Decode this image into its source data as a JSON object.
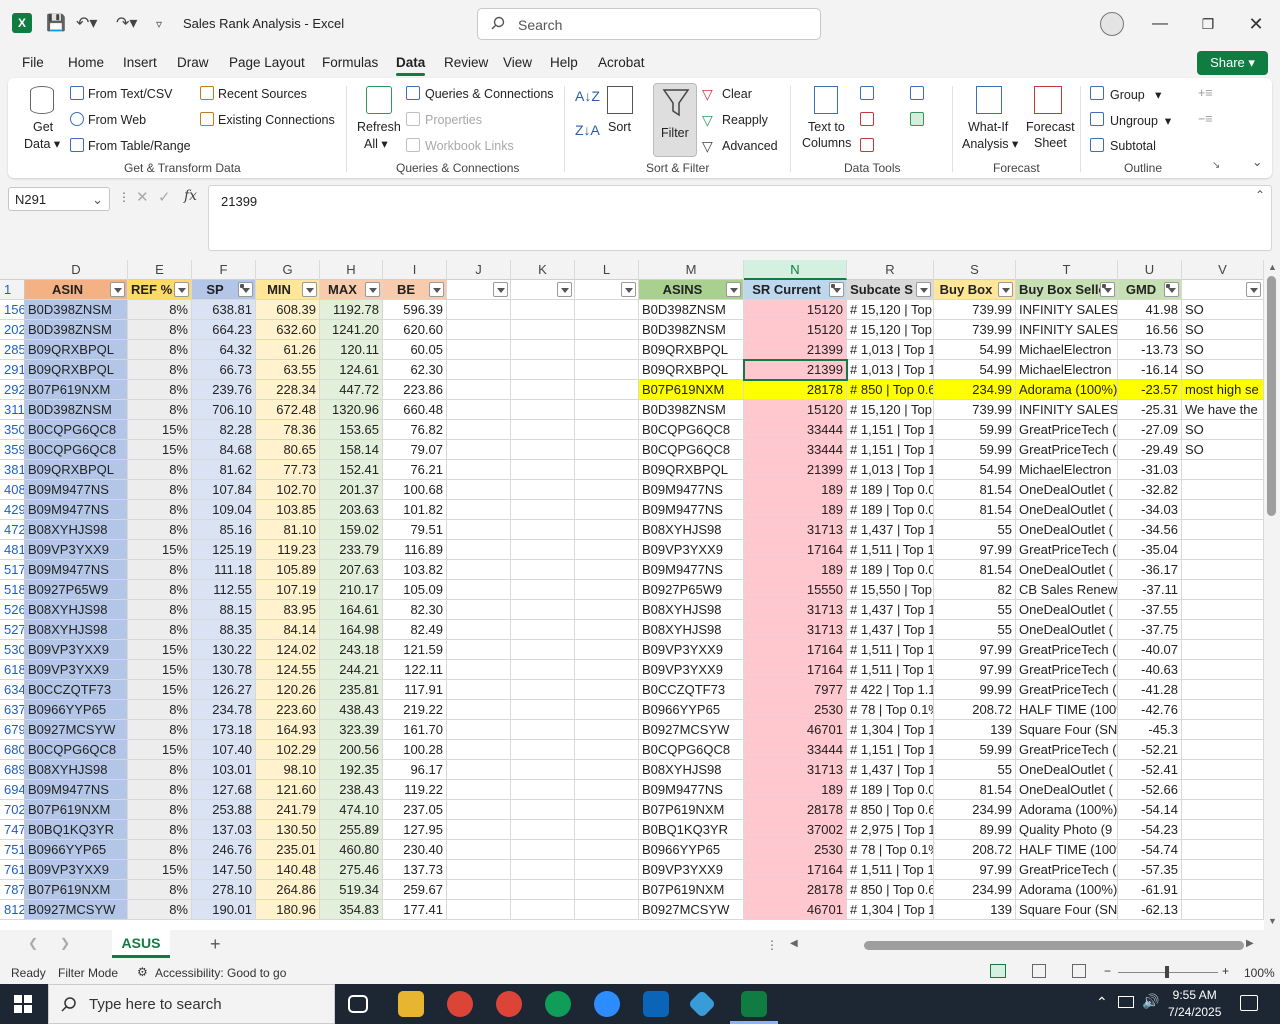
{
  "app": {
    "title": "Sales Rank Analysis  -  Excel",
    "logo": "X"
  },
  "search": {
    "placeholder": "Search"
  },
  "menu": [
    "File",
    "Home",
    "Insert",
    "Draw",
    "Page Layout",
    "Formulas",
    "Data",
    "Review",
    "View",
    "Help",
    "Acrobat"
  ],
  "active_menu": "Data",
  "share_label": "Share",
  "ribbon": {
    "get_data": [
      "Get",
      "Data"
    ],
    "from_text_csv": "From Text/CSV",
    "from_web": "From Web",
    "from_table": "From Table/Range",
    "recent_sources": "Recent Sources",
    "existing_connections": "Existing Connections",
    "group_get_transform": "Get & Transform Data",
    "refresh": [
      "Refresh",
      "All"
    ],
    "queries_connections": "Queries & Connections",
    "properties": "Properties",
    "workbook_links": "Workbook Links",
    "group_queries": "Queries & Connections",
    "sort": "Sort",
    "filter": "Filter",
    "clear": "Clear",
    "reapply": "Reapply",
    "advanced": "Advanced",
    "group_sort": "Sort & Filter",
    "text_to_columns": [
      "Text to",
      "Columns"
    ],
    "group_data_tools": "Data Tools",
    "what_if": [
      "What-If",
      "Analysis"
    ],
    "forecast_sheet": [
      "Forecast",
      "Sheet"
    ],
    "group_forecast": "Forecast",
    "group": "Group",
    "ungroup": "Ungroup",
    "subtotal": "Subtotal",
    "group_outline": "Outline"
  },
  "formula_bar": {
    "name_box": "N291",
    "fx": "fx",
    "value": "21399"
  },
  "columns": [
    "D",
    "E",
    "F",
    "G",
    "H",
    "I",
    "J",
    "K",
    "L",
    "M",
    "N",
    "R",
    "S",
    "T",
    "U",
    "V"
  ],
  "header_row": {
    "row": "1",
    "D": "ASIN",
    "E": "REF %",
    "F": "SP",
    "G": "MIN",
    "H": "MAX",
    "I": "BE",
    "M": "ASINS",
    "N": "SR Current",
    "R": "Subcate S",
    "S": "Buy Box",
    "T": "Buy Box Selle",
    "U": "GMD"
  },
  "rows": [
    {
      "r": "156",
      "D": "B0D398ZNSM",
      "E": "8%",
      "F": "638.81",
      "G": "608.39",
      "H": "1192.78",
      "I": "596.39",
      "M": "B0D398ZNSM",
      "N": "15120",
      "R": "# 15,120 | Top",
      "S": "739.99",
      "T": "INFINITY SALES C",
      "U": "41.98",
      "V": "SO"
    },
    {
      "r": "202",
      "D": "B0D398ZNSM",
      "E": "8%",
      "F": "664.23",
      "G": "632.60",
      "H": "1241.20",
      "I": "620.60",
      "M": "B0D398ZNSM",
      "N": "15120",
      "R": "# 15,120 | Top",
      "S": "739.99",
      "T": "INFINITY SALES C",
      "U": "16.56",
      "V": "SO"
    },
    {
      "r": "285",
      "D": "B09QRXBPQL",
      "E": "8%",
      "F": "64.32",
      "G": "61.26",
      "H": "120.11",
      "I": "60.05",
      "M": "B09QRXBPQL",
      "N": "21399",
      "R": "# 1,013 | Top 1",
      "S": "54.99",
      "T": "MichaelElectron",
      "U": "-13.73",
      "V": "SO"
    },
    {
      "r": "291",
      "D": "B09QRXBPQL",
      "E": "8%",
      "F": "66.73",
      "G": "63.55",
      "H": "124.61",
      "I": "62.30",
      "M": "B09QRXBPQL",
      "N": "21399",
      "R": "# 1,013 | Top 1",
      "S": "54.99",
      "T": "MichaelElectron",
      "U": "-16.14",
      "V": "SO"
    },
    {
      "r": "292",
      "D": "B07P619NXM",
      "E": "8%",
      "F": "239.76",
      "G": "228.34",
      "H": "447.72",
      "I": "223.86",
      "M": "B07P619NXM",
      "N": "28178",
      "R": "# 850 | Top 0.6",
      "S": "234.99",
      "T": "Adorama (100%)",
      "U": "-23.57",
      "V": "most high se",
      "hl": true
    },
    {
      "r": "311",
      "D": "B0D398ZNSM",
      "E": "8%",
      "F": "706.10",
      "G": "672.48",
      "H": "1320.96",
      "I": "660.48",
      "M": "B0D398ZNSM",
      "N": "15120",
      "R": "# 15,120 | Top",
      "S": "739.99",
      "T": "INFINITY SALES C",
      "U": "-25.31",
      "V": "We have the"
    },
    {
      "r": "350",
      "D": "B0CQPG6QC8",
      "E": "15%",
      "F": "82.28",
      "G": "78.36",
      "H": "153.65",
      "I": "76.82",
      "M": "B0CQPG6QC8",
      "N": "33444",
      "R": "# 1,151 | Top 1",
      "S": "59.99",
      "T": "GreatPriceTech (",
      "U": "-27.09",
      "V": "SO"
    },
    {
      "r": "359",
      "D": "B0CQPG6QC8",
      "E": "15%",
      "F": "84.68",
      "G": "80.65",
      "H": "158.14",
      "I": "79.07",
      "M": "B0CQPG6QC8",
      "N": "33444",
      "R": "# 1,151 | Top 1",
      "S": "59.99",
      "T": "GreatPriceTech (",
      "U": "-29.49",
      "V": "SO"
    },
    {
      "r": "381",
      "D": "B09QRXBPQL",
      "E": "8%",
      "F": "81.62",
      "G": "77.73",
      "H": "152.41",
      "I": "76.21",
      "M": "B09QRXBPQL",
      "N": "21399",
      "R": "# 1,013 | Top 1",
      "S": "54.99",
      "T": "MichaelElectron",
      "U": "-31.03",
      "V": ""
    },
    {
      "r": "408",
      "D": "B09M9477NS",
      "E": "8%",
      "F": "107.84",
      "G": "102.70",
      "H": "201.37",
      "I": "100.68",
      "M": "B09M9477NS",
      "N": "189",
      "R": "# 189 | Top 0.0",
      "S": "81.54",
      "T": "OneDealOutlet (",
      "U": "-32.82",
      "V": ""
    },
    {
      "r": "429",
      "D": "B09M9477NS",
      "E": "8%",
      "F": "109.04",
      "G": "103.85",
      "H": "203.63",
      "I": "101.82",
      "M": "B09M9477NS",
      "N": "189",
      "R": "# 189 | Top 0.0",
      "S": "81.54",
      "T": "OneDealOutlet (",
      "U": "-34.03",
      "V": ""
    },
    {
      "r": "472",
      "D": "B08XYHJS98",
      "E": "8%",
      "F": "85.16",
      "G": "81.10",
      "H": "159.02",
      "I": "79.51",
      "M": "B08XYHJS98",
      "N": "31713",
      "R": "# 1,437 | Top 1",
      "S": "55",
      "T": "OneDealOutlet (",
      "U": "-34.56",
      "V": ""
    },
    {
      "r": "481",
      "D": "B09VP3YXX9",
      "E": "15%",
      "F": "125.19",
      "G": "119.23",
      "H": "233.79",
      "I": "116.89",
      "M": "B09VP3YXX9",
      "N": "17164",
      "R": "# 1,511 | Top 1",
      "S": "97.99",
      "T": "GreatPriceTech (",
      "U": "-35.04",
      "V": ""
    },
    {
      "r": "517",
      "D": "B09M9477NS",
      "E": "8%",
      "F": "111.18",
      "G": "105.89",
      "H": "207.63",
      "I": "103.82",
      "M": "B09M9477NS",
      "N": "189",
      "R": "# 189 | Top 0.0",
      "S": "81.54",
      "T": "OneDealOutlet (",
      "U": "-36.17",
      "V": ""
    },
    {
      "r": "518",
      "D": "B0927P65W9",
      "E": "8%",
      "F": "112.55",
      "G": "107.19",
      "H": "210.17",
      "I": "105.09",
      "M": "B0927P65W9",
      "N": "15550",
      "R": "# 15,550 | Top",
      "S": "82",
      "T": "CB Sales Renew",
      "U": "-37.11",
      "V": ""
    },
    {
      "r": "526",
      "D": "B08XYHJS98",
      "E": "8%",
      "F": "88.15",
      "G": "83.95",
      "H": "164.61",
      "I": "82.30",
      "M": "B08XYHJS98",
      "N": "31713",
      "R": "# 1,437 | Top 1",
      "S": "55",
      "T": "OneDealOutlet (",
      "U": "-37.55",
      "V": ""
    },
    {
      "r": "527",
      "D": "B08XYHJS98",
      "E": "8%",
      "F": "88.35",
      "G": "84.14",
      "H": "164.98",
      "I": "82.49",
      "M": "B08XYHJS98",
      "N": "31713",
      "R": "# 1,437 | Top 1",
      "S": "55",
      "T": "OneDealOutlet (",
      "U": "-37.75",
      "V": ""
    },
    {
      "r": "530",
      "D": "B09VP3YXX9",
      "E": "15%",
      "F": "130.22",
      "G": "124.02",
      "H": "243.18",
      "I": "121.59",
      "M": "B09VP3YXX9",
      "N": "17164",
      "R": "# 1,511 | Top 1",
      "S": "97.99",
      "T": "GreatPriceTech (",
      "U": "-40.07",
      "V": ""
    },
    {
      "r": "618",
      "D": "B09VP3YXX9",
      "E": "15%",
      "F": "130.78",
      "G": "124.55",
      "H": "244.21",
      "I": "122.11",
      "M": "B09VP3YXX9",
      "N": "17164",
      "R": "# 1,511 | Top 1",
      "S": "97.99",
      "T": "GreatPriceTech (",
      "U": "-40.63",
      "V": ""
    },
    {
      "r": "634",
      "D": "B0CCZQTF73",
      "E": "15%",
      "F": "126.27",
      "G": "120.26",
      "H": "235.81",
      "I": "117.91",
      "M": "B0CCZQTF73",
      "N": "7977",
      "R": "# 422 | Top 1.1",
      "S": "99.99",
      "T": "GreatPriceTech (",
      "U": "-41.28",
      "V": ""
    },
    {
      "r": "637",
      "D": "B0966YYP65",
      "E": "8%",
      "F": "234.78",
      "G": "223.60",
      "H": "438.43",
      "I": "219.22",
      "M": "B0966YYP65",
      "N": "2530",
      "R": "# 78 | Top 0.1%",
      "S": "208.72",
      "T": "HALF TIME (100%",
      "U": "-42.76",
      "V": ""
    },
    {
      "r": "679",
      "D": "B0927MCSYW",
      "E": "8%",
      "F": "173.18",
      "G": "164.93",
      "H": "323.39",
      "I": "161.70",
      "M": "B0927MCSYW",
      "N": "46701",
      "R": "# 1,304 | Top 1",
      "S": "139",
      "T": "Square Four (SN",
      "U": "-45.3",
      "V": ""
    },
    {
      "r": "680",
      "D": "B0CQPG6QC8",
      "E": "15%",
      "F": "107.40",
      "G": "102.29",
      "H": "200.56",
      "I": "100.28",
      "M": "B0CQPG6QC8",
      "N": "33444",
      "R": "# 1,151 | Top 1",
      "S": "59.99",
      "T": "GreatPriceTech (",
      "U": "-52.21",
      "V": ""
    },
    {
      "r": "689",
      "D": "B08XYHJS98",
      "E": "8%",
      "F": "103.01",
      "G": "98.10",
      "H": "192.35",
      "I": "96.17",
      "M": "B08XYHJS98",
      "N": "31713",
      "R": "# 1,437 | Top 1",
      "S": "55",
      "T": "OneDealOutlet (",
      "U": "-52.41",
      "V": ""
    },
    {
      "r": "694",
      "D": "B09M9477NS",
      "E": "8%",
      "F": "127.68",
      "G": "121.60",
      "H": "238.43",
      "I": "119.22",
      "M": "B09M9477NS",
      "N": "189",
      "R": "# 189 | Top 0.0",
      "S": "81.54",
      "T": "OneDealOutlet (",
      "U": "-52.66",
      "V": ""
    },
    {
      "r": "702",
      "D": "B07P619NXM",
      "E": "8%",
      "F": "253.88",
      "G": "241.79",
      "H": "474.10",
      "I": "237.05",
      "M": "B07P619NXM",
      "N": "28178",
      "R": "# 850 | Top 0.6",
      "S": "234.99",
      "T": "Adorama (100%)",
      "U": "-54.14",
      "V": ""
    },
    {
      "r": "747",
      "D": "B0BQ1KQ3YR",
      "E": "8%",
      "F": "137.03",
      "G": "130.50",
      "H": "255.89",
      "I": "127.95",
      "M": "B0BQ1KQ3YR",
      "N": "37002",
      "R": "# 2,975 | Top 1",
      "S": "89.99",
      "T": "Quality Photo (9",
      "U": "-54.23",
      "V": ""
    },
    {
      "r": "751",
      "D": "B0966YYP65",
      "E": "8%",
      "F": "246.76",
      "G": "235.01",
      "H": "460.80",
      "I": "230.40",
      "M": "B0966YYP65",
      "N": "2530",
      "R": "# 78 | Top 0.1%",
      "S": "208.72",
      "T": "HALF TIME (100%",
      "U": "-54.74",
      "V": ""
    },
    {
      "r": "761",
      "D": "B09VP3YXX9",
      "E": "15%",
      "F": "147.50",
      "G": "140.48",
      "H": "275.46",
      "I": "137.73",
      "M": "B09VP3YXX9",
      "N": "17164",
      "R": "# 1,511 | Top 1",
      "S": "97.99",
      "T": "GreatPriceTech (",
      "U": "-57.35",
      "V": ""
    },
    {
      "r": "787",
      "D": "B07P619NXM",
      "E": "8%",
      "F": "278.10",
      "G": "264.86",
      "H": "519.34",
      "I": "259.67",
      "M": "B07P619NXM",
      "N": "28178",
      "R": "# 850 | Top 0.6",
      "S": "234.99",
      "T": "Adorama (100%)",
      "U": "-61.91",
      "V": ""
    },
    {
      "r": "812",
      "D": "B0927MCSYW",
      "E": "8%",
      "F": "190.01",
      "G": "180.96",
      "H": "354.83",
      "I": "177.41",
      "M": "B0927MCSYW",
      "N": "46701",
      "R": "# 1,304 | Top 1",
      "S": "139",
      "T": "Square Four (SN",
      "U": "-62.13",
      "V": ""
    }
  ],
  "sheet": {
    "tab": "ASUS",
    "add": "+"
  },
  "status": {
    "ready": "Ready",
    "mode": "Filter Mode",
    "accessibility": "Accessibility: Good to go",
    "zoom": "100%"
  },
  "taskbar": {
    "search_placeholder": "Type here to search",
    "time": "9:55 AM",
    "date": "7/24/2025"
  },
  "colors": {
    "accent": "#107c41",
    "asin_bg": "#b4c6e7",
    "ref_bg": "#ededed",
    "sp_bg": "#dae3f3",
    "min_bg": "#fff2cc",
    "max_bg": "#e2efda",
    "sr_bg": "#ffc7ce",
    "highlight": "#ffff00"
  }
}
